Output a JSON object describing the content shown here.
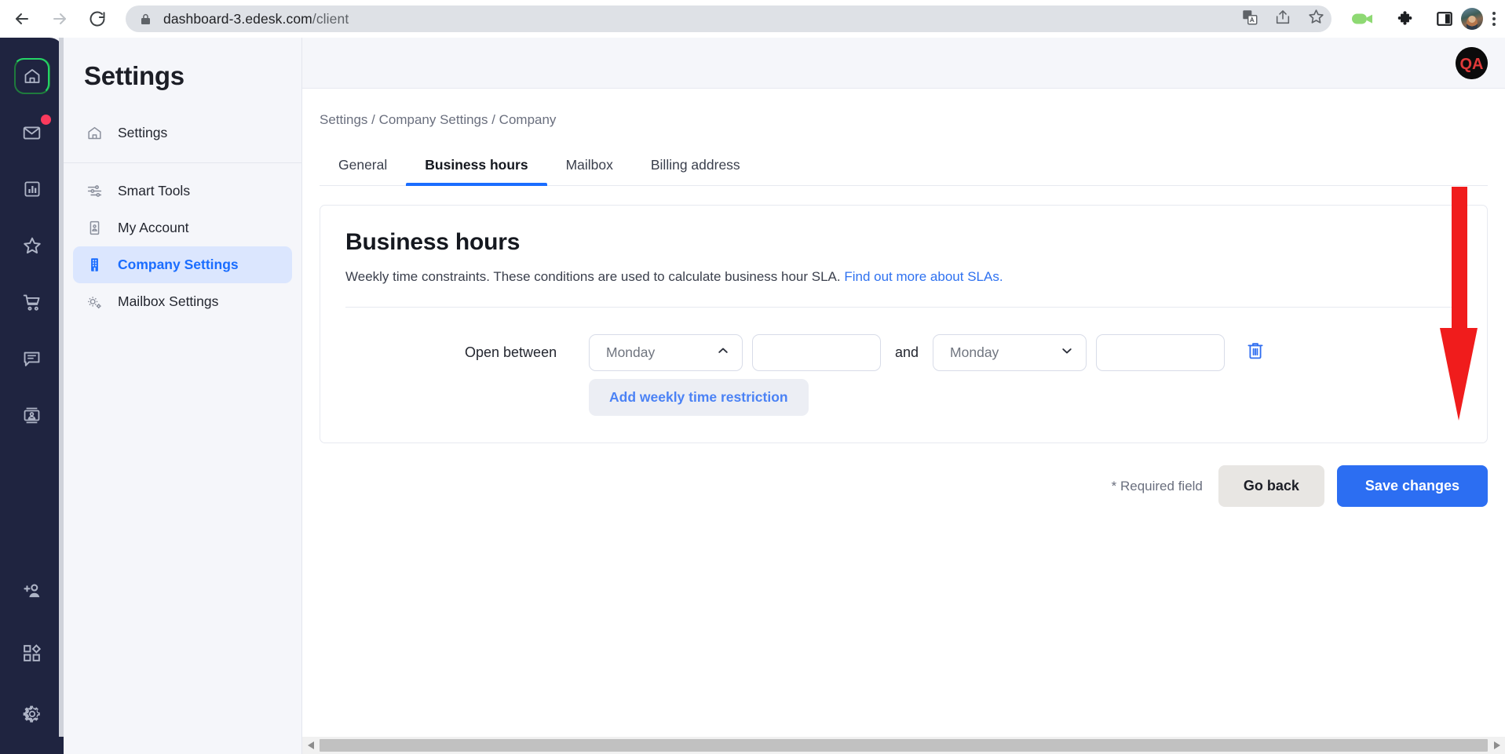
{
  "browser": {
    "back_icon": "arrow-left-icon",
    "forward_icon": "arrow-right-icon",
    "reload_icon": "reload-icon",
    "lock_icon": "lock-icon",
    "url_host": "dashboard-3.edesk.com",
    "url_path": "/client",
    "translate_icon": "translate-icon",
    "share_icon": "share-icon",
    "bookmark_icon": "star-outline-icon",
    "extension_icons": [
      "video-camera-icon",
      "puzzle-piece-icon",
      "side-panel-icon"
    ],
    "profile_icon": "profile-avatar",
    "menu_icon": "kebab-menu-icon"
  },
  "rail": {
    "items": [
      {
        "name": "home",
        "icon": "home-icon",
        "active": true,
        "badge": false
      },
      {
        "name": "mailbox",
        "icon": "envelope-icon",
        "active": false,
        "badge": true
      },
      {
        "name": "reports",
        "icon": "bar-chart-icon",
        "active": false,
        "badge": false
      },
      {
        "name": "favourites",
        "icon": "star-icon",
        "active": false,
        "badge": false
      },
      {
        "name": "orders",
        "icon": "shopping-cart-icon",
        "active": false,
        "badge": false
      },
      {
        "name": "live-chat",
        "icon": "chat-bubble-icon",
        "active": false,
        "badge": false
      },
      {
        "name": "contacts",
        "icon": "contact-card-icon",
        "active": false,
        "badge": false
      }
    ],
    "bottom_items": [
      {
        "name": "invite-user",
        "icon": "add-person-icon"
      },
      {
        "name": "apps",
        "icon": "apps-grid-icon"
      },
      {
        "name": "settings",
        "icon": "gear-icon"
      }
    ]
  },
  "settings_nav": {
    "title": "Settings",
    "top_item": {
      "label": "Settings",
      "icon": "home-icon"
    },
    "items": [
      {
        "label": "Smart Tools",
        "icon": "sliders-icon",
        "selected": false
      },
      {
        "label": "My Account",
        "icon": "id-card-icon",
        "selected": false
      },
      {
        "label": "Company Settings",
        "icon": "building-icon",
        "selected": true
      },
      {
        "label": "Mailbox Settings",
        "icon": "gears-icon",
        "selected": false
      }
    ]
  },
  "main": {
    "breadcrumb": "Settings / Company Settings / Company",
    "tabs": [
      {
        "label": "General",
        "active": false
      },
      {
        "label": "Business hours",
        "active": true
      },
      {
        "label": "Mailbox",
        "active": false
      },
      {
        "label": "Billing address",
        "active": false
      }
    ],
    "card": {
      "title": "Business hours",
      "description": "Weekly time constraints. These conditions are used to calculate business hour SLA.",
      "link_text": "Find out more about SLAs.",
      "row_label": "Open between",
      "conjunction": "and",
      "start_day": "Monday",
      "start_day_chevron": "chevron-up-icon",
      "start_time_value": "",
      "start_time_placeholder": "",
      "end_day": "Monday",
      "end_day_chevron": "chevron-down-icon",
      "end_time_value": "",
      "end_time_placeholder": "",
      "clock_icon": "clock-icon",
      "delete_icon": "trash-icon",
      "add_restriction_label": "Add weekly time restriction"
    },
    "footer": {
      "required_note": "* Required field",
      "go_back_label": "Go back",
      "save_label": "Save changes"
    },
    "avatar_text": "QA"
  },
  "annotation": {
    "arrow": "red-down-arrow",
    "target": "trash-icon"
  },
  "colors": {
    "accent_blue": "#2c6ef2",
    "link_blue": "#2e71f0",
    "nav_selected_bg": "#dbe6fe",
    "rail_bg": "#1f2440",
    "badge_red": "#fb3a5d",
    "annotation_red": "#f01c1c",
    "delete_blue": "#2f6df0"
  },
  "scrollbar": {
    "left_arrow": "caret-left-icon",
    "right_arrow": "caret-right-icon"
  }
}
